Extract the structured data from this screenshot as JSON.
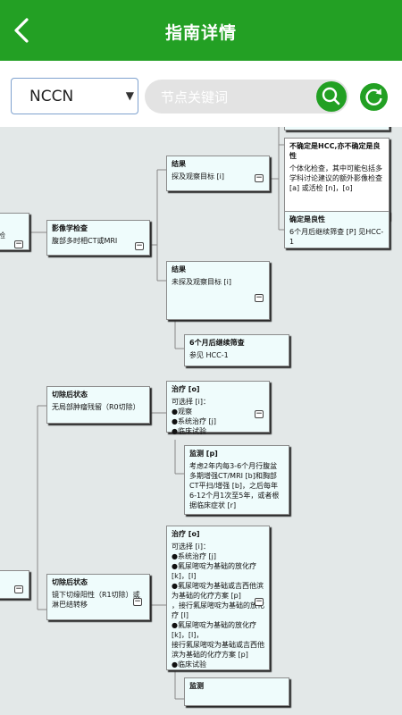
{
  "header": {
    "title": "指南详情"
  },
  "toolbar": {
    "guideline_selected": "NCCN",
    "search_placeholder": "节点关键词"
  },
  "icons": {
    "back": "back-chevron-icon",
    "search": "search-icon",
    "refresh": "refresh-icon",
    "collapse": "minus-icon",
    "dropdown": "caret-down-icon"
  },
  "colors": {
    "brand": "#23a024",
    "node_bg": "#effcfc",
    "canvas_bg": "#e3e8e8"
  },
  "nodes": {
    "undetermined": {
      "title": "不确定是HCC,亦不确定是良性",
      "text": "个体化检查，其中可能包括多学科讨论建议的额外影像检查 [a] 或活检 [n]，[o]"
    },
    "result_detected": {
      "title": "结果",
      "text": "探及观察目标 [i]"
    },
    "benign": {
      "title": "确定是良性",
      "text": "6个月后继续筛查 [P] 见HCC-1"
    },
    "left_edge": {
      "text": "检"
    },
    "imaging": {
      "title": "影像学检查",
      "text": "腹部多时相CT或MRI"
    },
    "result_not_detected": {
      "title": "结果",
      "text": "未探及观察目标 [i]"
    },
    "rescreen": {
      "title": "6个月后继续筛查",
      "text": "参见 HCC-1"
    },
    "post_resection": {
      "title": "切除后状态",
      "text": "无局部肿瘤残留（R0切除）"
    },
    "treatment1": {
      "title": "治疗 [o]",
      "text": "可选择 [i]：\n●观察\n●系统治疗 [j]\n●临床试验"
    },
    "monitoring1": {
      "title": "监测 [p]",
      "text": "考虑2年内每3-6个月行腹盆多期增强CT/MRI [b]和胸部CT平扫/增强 [b]，之后每年6-12个月1次至5年，或者根据临床症状 [r]"
    },
    "post_resection2": {
      "title": "切除后状态",
      "text": "镜下切缘阳性（R1切除）或\n淋巴结转移"
    },
    "treatment2": {
      "title": "治疗 [o]",
      "text": "可选择 [i]：\n●系统治疗 [j]\n●氟尿嘧啶为基础的放化疗 [k]，[l]\n●氟尿嘧啶为基础或吉西他滨为基础的化疗方案 [p]\n，接行氟尿嘧啶为基础的放化疗 [l]\n●氟尿嘧啶为基础的放化疗 [k]，[l]，\n接行氟尿嘧啶为基础或吉西他滨为基础的化疗方案 [p]\n●临床试验"
    },
    "monitoring2": {
      "title": "监测",
      "text": ""
    }
  }
}
